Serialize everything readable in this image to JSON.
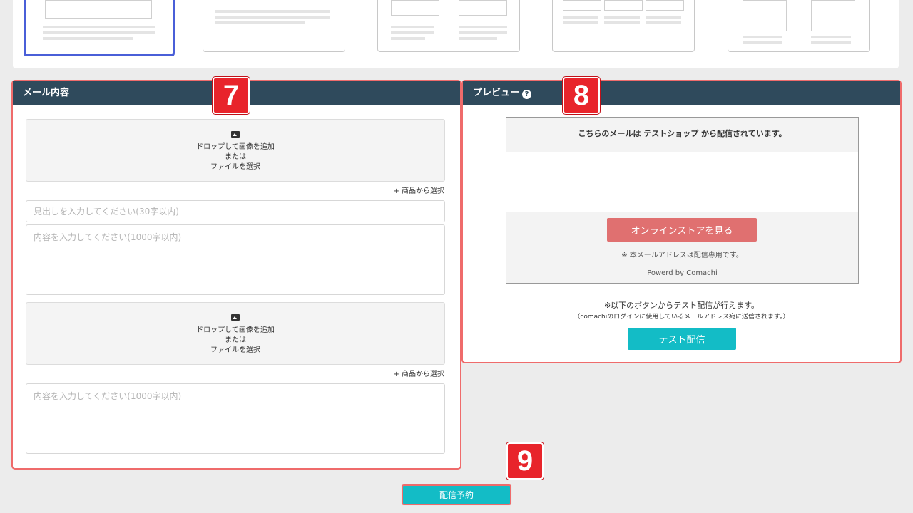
{
  "templates": [
    "template-1",
    "template-2",
    "template-3",
    "template-4",
    "template-5"
  ],
  "mail_content": {
    "title": "メール内容",
    "drop_zone_1": {
      "line1": "ドロップして画像を追加",
      "line2": "または",
      "line3": "ファイルを選択"
    },
    "product_link_1": "+ 商品から選択",
    "heading_placeholder": "見出しを入力してください(30字以内)",
    "body_placeholder_1": "内容を入力してください(1000字以内)",
    "drop_zone_2": {
      "line1": "ドロップして画像を追加",
      "line2": "または",
      "line3": "ファイルを選択"
    },
    "product_link_2": "+ 商品から選択",
    "body_placeholder_2": "内容を入力してください(1000字以内)"
  },
  "preview": {
    "title": "プレビュー",
    "help": "?",
    "header_text": "こちらのメールは テストショップ から配信されています。",
    "store_button": "オンラインストアを見る",
    "note": "※ 本メールアドレスは配信専用です。",
    "powered": "Powerd by Comachi",
    "test_note_1": "※以下のボタンからテスト配信が行えます。",
    "test_note_2": "（comachiのログインに使用しているメールアドレス宛に送信されます。）",
    "test_button": "テスト配信"
  },
  "badges": {
    "b7": "7",
    "b8": "8",
    "b9": "9"
  },
  "submit_button": "配信予約",
  "colors": {
    "header": "#2f4a5c",
    "accent": "#13bcc6",
    "store_button": "#e07070",
    "highlight": "#ef6b6b",
    "badge": "#e8242b"
  }
}
